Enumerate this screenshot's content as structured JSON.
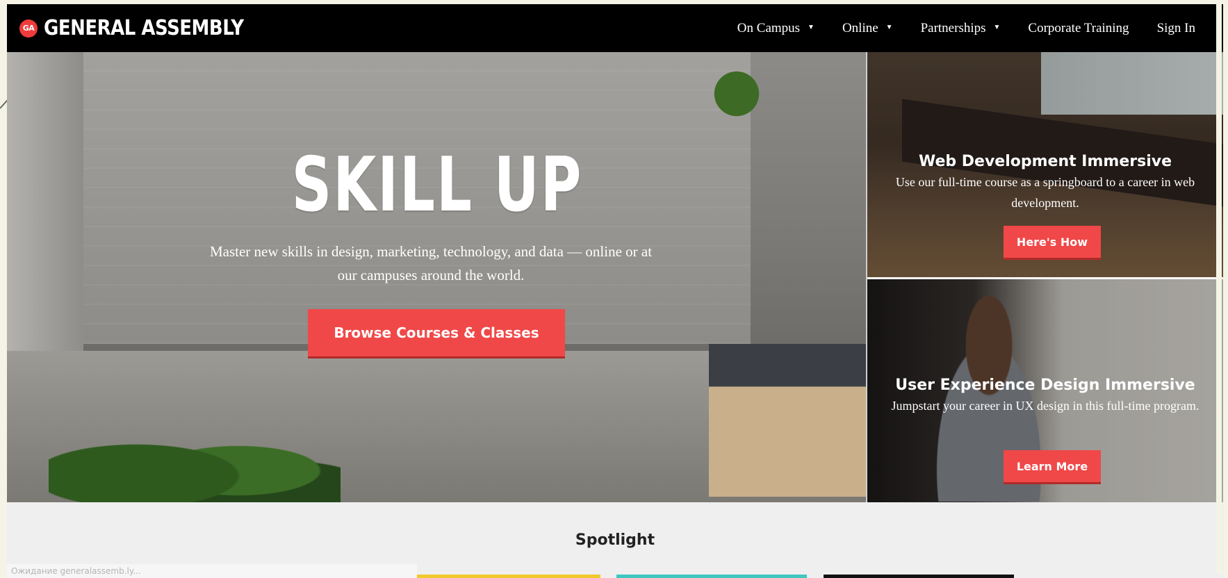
{
  "brand": {
    "badge": "GA",
    "name": "GENERAL ASSEMBLY",
    "accent_color": "#f04848"
  },
  "nav": {
    "items": [
      {
        "label": "On Campus",
        "has_dropdown": true
      },
      {
        "label": "Online",
        "has_dropdown": true
      },
      {
        "label": "Partnerships",
        "has_dropdown": true
      },
      {
        "label": "Corporate Training",
        "has_dropdown": false
      },
      {
        "label": "Sign In",
        "has_dropdown": false
      }
    ],
    "caret": "▼"
  },
  "hero": {
    "title": "SKILL UP",
    "subtitle": "Master new skills in design, marketing, technology, and data — online or at our campuses around the world.",
    "cta_label": "Browse Courses & Classes"
  },
  "cards": [
    {
      "title": "Web Development Immersive",
      "description": "Use our full-time course as a springboard to a career in web development.",
      "button_label": "Here's How"
    },
    {
      "title": "User Experience Design Immersive",
      "description": "Jumpstart your career in UX design in this full-time program.",
      "button_label": "Learn More"
    }
  ],
  "spotlight": {
    "title": "Spotlight",
    "tile_colors": [
      "#ef4b4b",
      "#f2c82f",
      "#3fc6c0",
      "#111111"
    ]
  },
  "status_bar": {
    "text": "Ожидание generalassemb.ly..."
  }
}
